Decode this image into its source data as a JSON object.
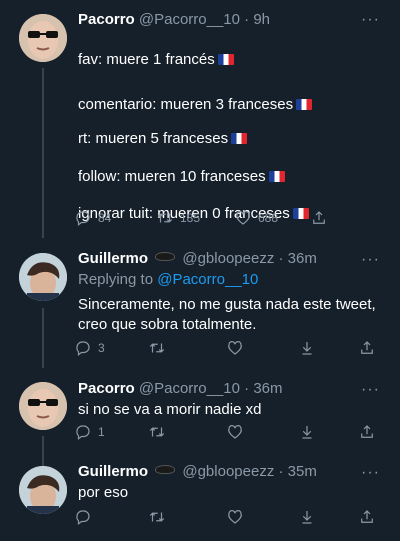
{
  "tweets": [
    {
      "name": "Pacorro",
      "handle": "@Pacorro__10",
      "time": "· 9h",
      "lines": [
        "fav: muere 1 francés",
        "comentario: mueren 3 franceses",
        "rt: mueren 5 franceses",
        "follow: mueren 10 franceses",
        "ignorar tuit: mueren 0 franceses"
      ],
      "replies": "84",
      "retweets": "185",
      "likes": "688"
    },
    {
      "name": "Guillermo",
      "handle": "@gbloopeezz",
      "time": "· 36m",
      "replying_prefix": "Replying to ",
      "replying_to": "@Pacorro__10",
      "text": "Sinceramente, no me gusta nada este tweet,\ncreo que sobra totalmente.",
      "replies": "3"
    },
    {
      "name": "Pacorro",
      "handle": "@Pacorro__10",
      "time": "· 36m",
      "text": "si no se va a morir nadie xd",
      "replies": "1"
    },
    {
      "name": "Guillermo",
      "handle": "@gbloopeezz",
      "time": "· 35m",
      "text": "por eso"
    }
  ],
  "colors": {
    "background": "#15202b",
    "muted": "#8b98a5",
    "link": "#1d9bf0",
    "thread_line": "#38444d"
  }
}
